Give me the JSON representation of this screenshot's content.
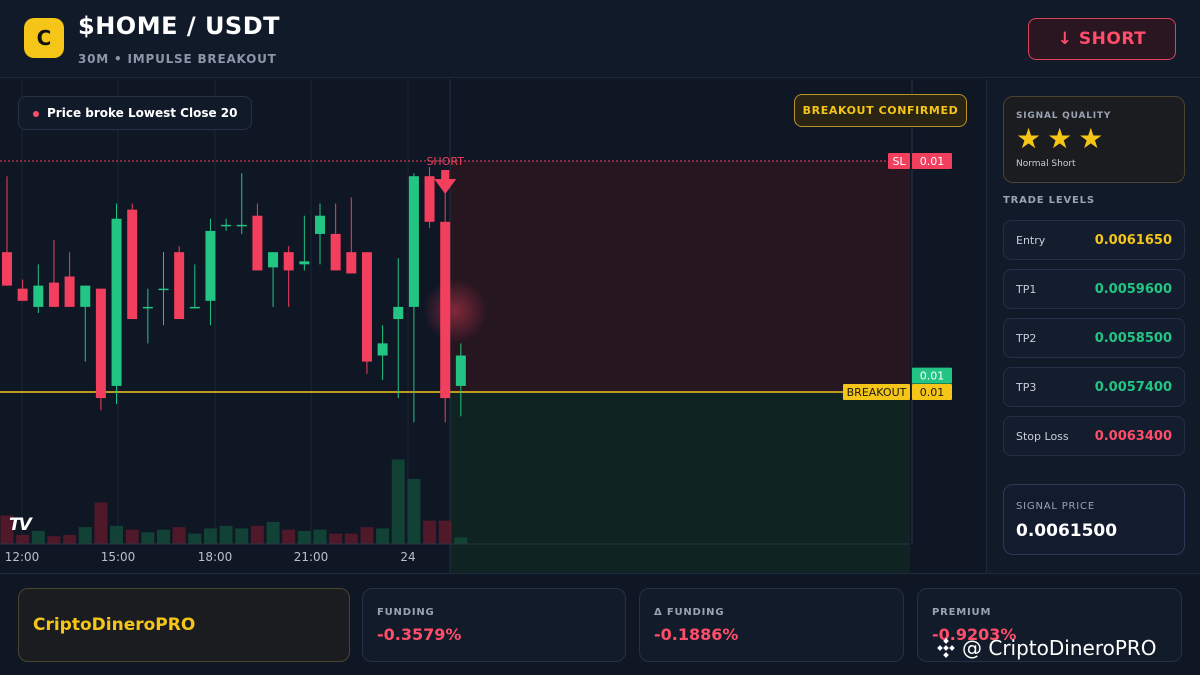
{
  "header": {
    "logo_letter": "C",
    "title": "$HOME / USDT",
    "subtitle": "30M • IMPULSE BREAKOUT",
    "action_label": "↓ SHORT"
  },
  "chart": {
    "badge_broke": "Price broke Lowest Close 20",
    "badge_confirmed": "BREAKOUT CONFIRMED",
    "short_marker": "SHORT",
    "sl_tag": "SL",
    "sl_value": "0.01",
    "tp_value": "0.01",
    "breakout_tag": "BREAKOUT",
    "breakout_value": "0.01",
    "tv_logo": "TV",
    "colors": {
      "up": "#22c583",
      "down": "#f23f5d",
      "breakout": "#f5c518"
    }
  },
  "chart_data": {
    "type": "candlestick",
    "x_ticks": [
      "12:00",
      "15:00",
      "18:00",
      "21:00",
      "24"
    ],
    "candles": [
      {
        "o": 0.00619,
        "h": 0.006315,
        "l": 0.006135,
        "c": 0.006135
      },
      {
        "o": 0.00613,
        "h": 0.006145,
        "l": 0.00611,
        "c": 0.00611
      },
      {
        "o": 0.0061,
        "h": 0.00617,
        "l": 0.00609,
        "c": 0.006135
      },
      {
        "o": 0.00614,
        "h": 0.00621,
        "l": 0.0061,
        "c": 0.0061
      },
      {
        "o": 0.00615,
        "h": 0.00619,
        "l": 0.0061,
        "c": 0.0061
      },
      {
        "o": 0.0061,
        "h": 0.006135,
        "l": 0.00601,
        "c": 0.006135
      },
      {
        "o": 0.00613,
        "h": 0.00613,
        "l": 0.00593,
        "c": 0.00595
      },
      {
        "o": 0.00597,
        "h": 0.00627,
        "l": 0.00594,
        "c": 0.006245
      },
      {
        "o": 0.00626,
        "h": 0.00627,
        "l": 0.00608,
        "c": 0.00608
      },
      {
        "o": 0.0061,
        "h": 0.00613,
        "l": 0.00604,
        "c": 0.0061
      },
      {
        "o": 0.00613,
        "h": 0.00619,
        "l": 0.00607,
        "c": 0.00613
      },
      {
        "o": 0.00619,
        "h": 0.0062,
        "l": 0.00608,
        "c": 0.00608
      },
      {
        "o": 0.0061,
        "h": 0.00617,
        "l": 0.0061,
        "c": 0.0061
      },
      {
        "o": 0.00611,
        "h": 0.006245,
        "l": 0.00607,
        "c": 0.006225
      },
      {
        "o": 0.006235,
        "h": 0.006245,
        "l": 0.006225,
        "c": 0.006235
      },
      {
        "o": 0.006235,
        "h": 0.00632,
        "l": 0.00622,
        "c": 0.006235
      },
      {
        "o": 0.00625,
        "h": 0.00627,
        "l": 0.00616,
        "c": 0.00616
      },
      {
        "o": 0.006165,
        "h": 0.00619,
        "l": 0.0061,
        "c": 0.00619
      },
      {
        "o": 0.00619,
        "h": 0.0062,
        "l": 0.0061,
        "c": 0.00616
      },
      {
        "o": 0.00617,
        "h": 0.00625,
        "l": 0.00616,
        "c": 0.006175
      },
      {
        "o": 0.00622,
        "h": 0.00627,
        "l": 0.00617,
        "c": 0.00625
      },
      {
        "o": 0.00622,
        "h": 0.00627,
        "l": 0.00616,
        "c": 0.00616
      },
      {
        "o": 0.00619,
        "h": 0.00628,
        "l": 0.006155,
        "c": 0.006155
      },
      {
        "o": 0.00619,
        "h": 0.00619,
        "l": 0.00599,
        "c": 0.00601
      },
      {
        "o": 0.00602,
        "h": 0.00607,
        "l": 0.00598,
        "c": 0.00604
      },
      {
        "o": 0.00608,
        "h": 0.00618,
        "l": 0.00595,
        "c": 0.0061
      },
      {
        "o": 0.0061,
        "h": 0.00632,
        "l": 0.00591,
        "c": 0.006315
      },
      {
        "o": 0.006315,
        "h": 0.00633,
        "l": 0.00623,
        "c": 0.00624
      },
      {
        "o": 0.00624,
        "h": 0.006315,
        "l": 0.00591,
        "c": 0.00595
      },
      {
        "o": 0.00597,
        "h": 0.00604,
        "l": 0.00592,
        "c": 0.00602
      }
    ],
    "volume": [
      22,
      7,
      10,
      6,
      7,
      13,
      32,
      14,
      11,
      9,
      11,
      13,
      8,
      12,
      14,
      12,
      14,
      17,
      11,
      10,
      11,
      8,
      8,
      13,
      12,
      65,
      50,
      18,
      18,
      5
    ],
    "levels": {
      "stop_loss": 0.00634,
      "breakout": 0.00596,
      "tp_marker": 0.00601
    }
  },
  "sidebar": {
    "quality_title": "SIGNAL QUALITY",
    "quality_label": "Normal Short",
    "stars_count": 3,
    "levels_title": "TRADE LEVELS",
    "levels": [
      {
        "label": "Entry",
        "value": "0.0061650",
        "color": "#f5c518"
      },
      {
        "label": "TP1",
        "value": "0.0059600",
        "color": "#22c583"
      },
      {
        "label": "TP2",
        "value": "0.0058500",
        "color": "#22c583"
      },
      {
        "label": "TP3",
        "value": "0.0057400",
        "color": "#22c583"
      },
      {
        "label": "Stop Loss",
        "value": "0.0063400",
        "color": "#ff4d6a"
      }
    ],
    "signal_price_label": "SIGNAL PRICE",
    "signal_price_value": "0.0061500"
  },
  "footer": {
    "brand": "CriptoDineroPRO",
    "funding_label": "FUNDING",
    "funding_value": "-0.3579%",
    "delta_funding_label": "Δ FUNDING",
    "delta_funding_value": "-0.1886%",
    "premium_label": "PREMIUM",
    "premium_value": "-0.9203%",
    "watermark": "@ CriptoDineroPRO"
  }
}
